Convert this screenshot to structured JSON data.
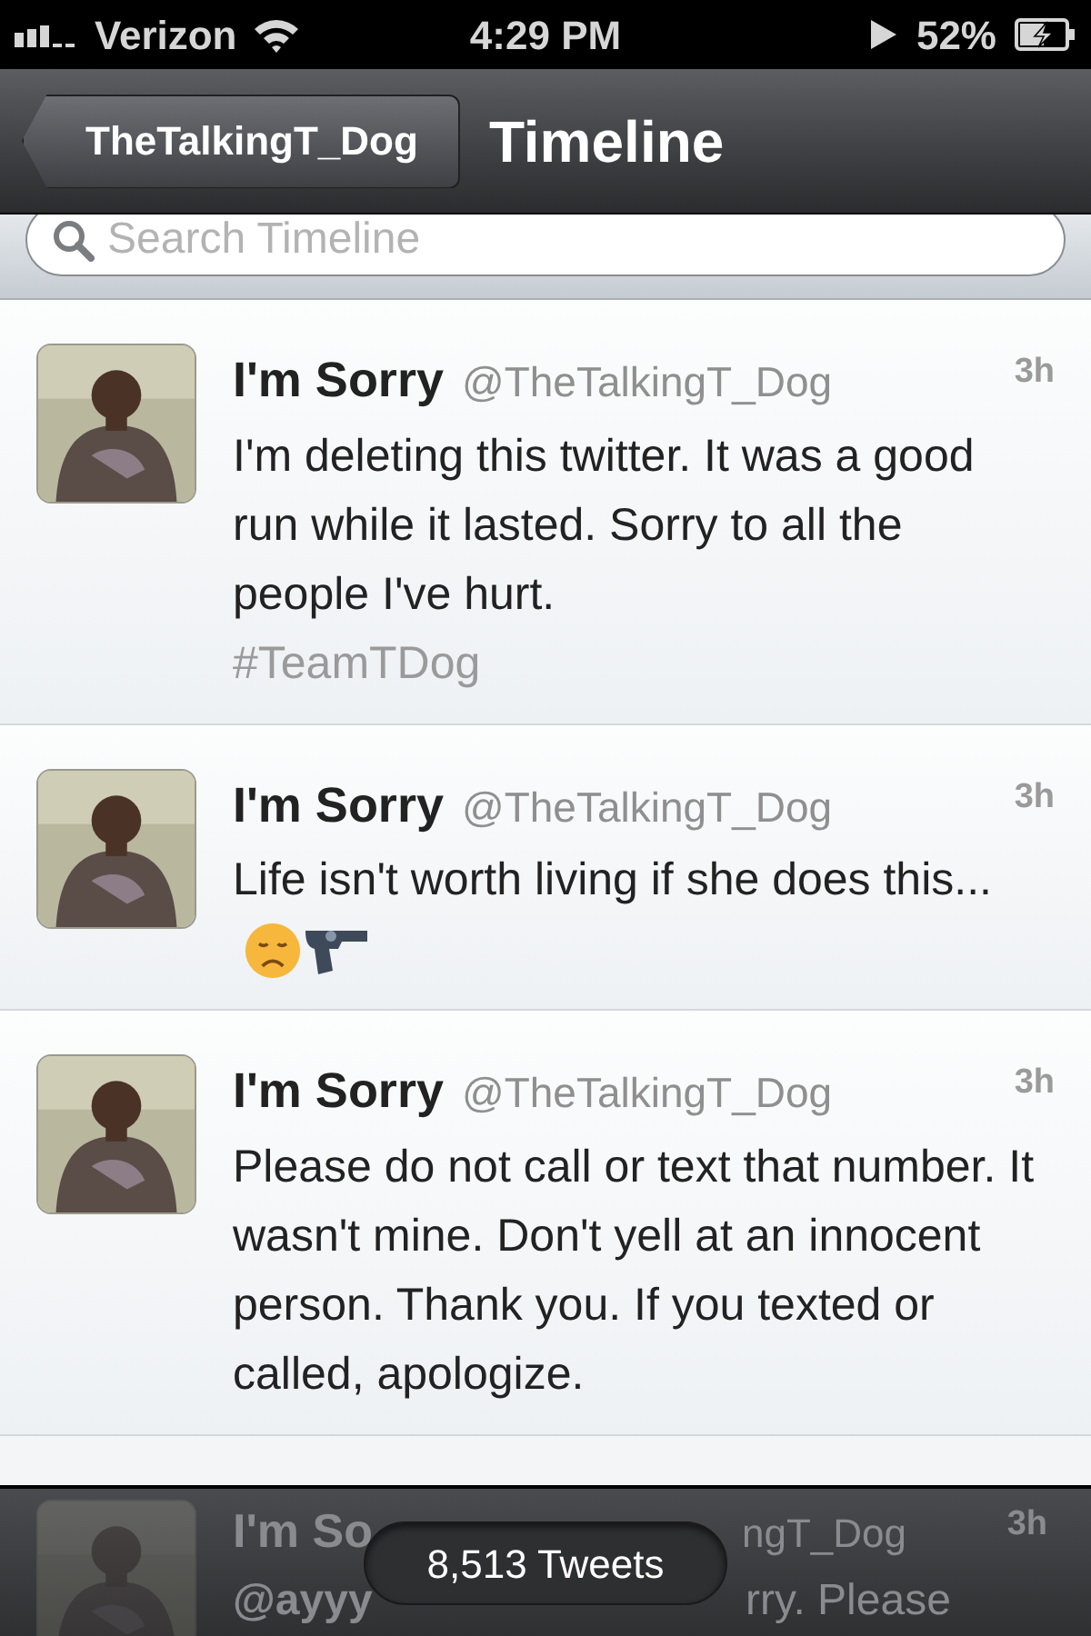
{
  "status_bar": {
    "carrier": "Verizon",
    "time": "4:29 PM",
    "battery": "52%"
  },
  "nav_bar": {
    "back_button": "TheTalkingT_Dog",
    "title": "Timeline"
  },
  "search": {
    "placeholder": "Search Timeline"
  },
  "tweets": [
    {
      "name": "I'm Sorry",
      "handle": "@TheTalkingT_Dog",
      "time": "3h",
      "text": "I'm deleting this twitter. It was a good run while it lasted. Sorry to all the people I've hurt.",
      "hashtag": "#TeamTDog",
      "emoji": false
    },
    {
      "name": "I'm Sorry",
      "handle": "@TheTalkingT_Dog",
      "time": "3h",
      "text": "Life isn't worth living if she does this...",
      "emoji": true
    },
    {
      "name": "I'm Sorry",
      "handle": "@TheTalkingT_Dog",
      "time": "3h",
      "text": "Please do not call or text that number. It wasn't mine. Don't yell at an innocent person. Thank you. If you texted or called, apologize.",
      "emoji": false
    }
  ],
  "hidden_tweet": {
    "name": "I'm So",
    "handle": "ngT_Dog",
    "time": "3h",
    "text_start": "@ayyy",
    "text_end": "rry. Please"
  },
  "tweet_count": "8,513 Tweets"
}
